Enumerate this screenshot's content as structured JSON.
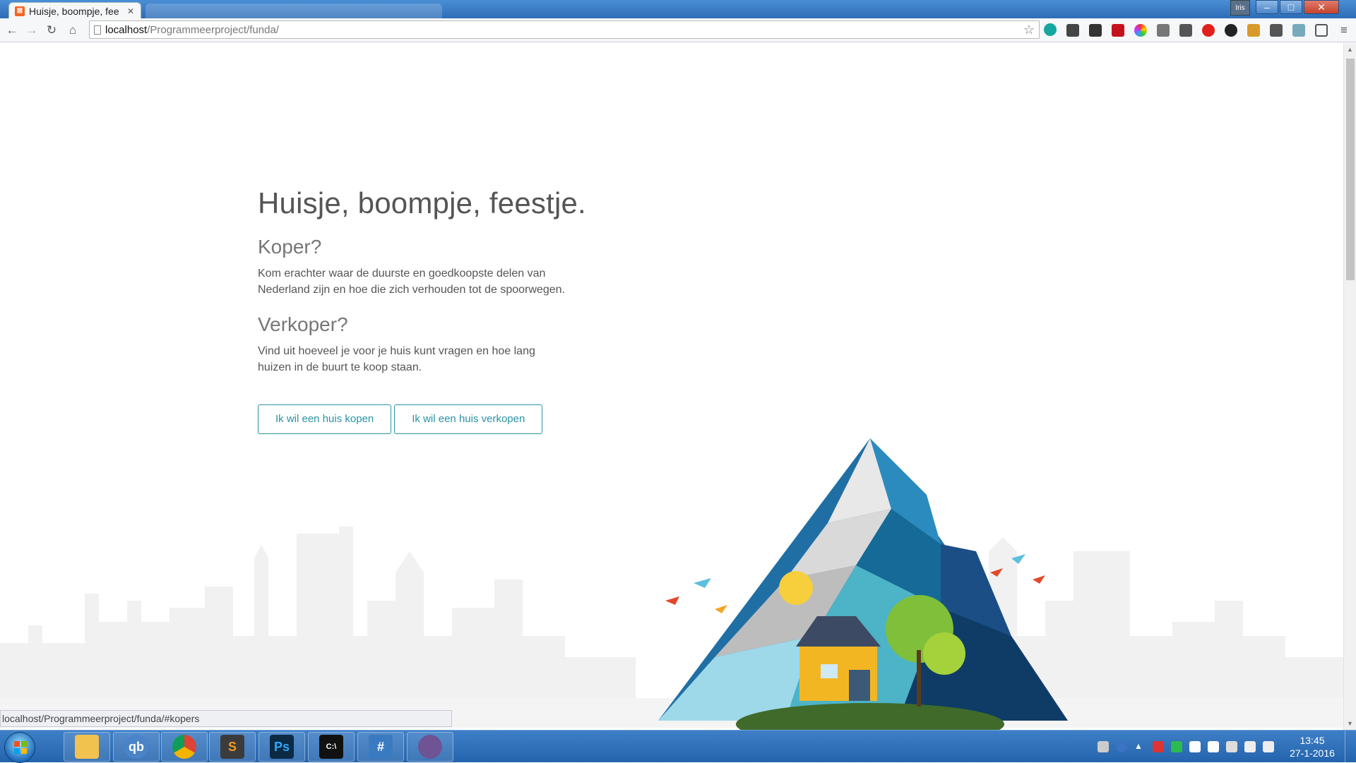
{
  "browser": {
    "tab_title": "Huisje, boompje, fee",
    "tab_close": "✕",
    "user_badge": "Iris",
    "url_host": "localhost",
    "url_path": "/Programmeerproject/funda/",
    "status_url": "localhost/Programmeerproject/funda/#kopers",
    "window_controls": {
      "minimize": "–",
      "maximize": "□",
      "close": "✕"
    }
  },
  "page": {
    "title": "Huisje, boompje, feestje.",
    "buyer_heading": "Koper?",
    "buyer_text": "Kom erachter waar de duurste en goedkoopste delen van Nederland zijn en hoe die zich verhouden tot de spoorwegen.",
    "seller_heading": "Verkoper?",
    "seller_text": "Vind uit hoeveel je voor je huis kunt vragen en hoe lang huizen in de buurt te koop staan.",
    "buy_button": "Ik wil een huis kopen",
    "sell_button": "Ik wil een huis verkopen",
    "accent_color": "#2a93a5"
  },
  "taskbar": {
    "apps": [
      {
        "name": "explorer",
        "label": ""
      },
      {
        "name": "qbittorrent",
        "label": "qb"
      },
      {
        "name": "chrome",
        "label": ""
      },
      {
        "name": "sublime-text",
        "label": "S"
      },
      {
        "name": "photoshop",
        "label": "Ps"
      },
      {
        "name": "terminal",
        "label": "C:\\"
      },
      {
        "name": "monodevelop",
        "label": "#"
      },
      {
        "name": "github",
        "label": ""
      }
    ],
    "time": "13:45",
    "date": "27-1-2016"
  }
}
